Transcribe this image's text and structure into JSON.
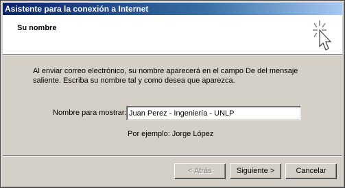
{
  "window": {
    "title": "Asistente para la conexión a Internet"
  },
  "header": {
    "title": "Su nombre",
    "icon": "wizard-cursor-sparkle-icon"
  },
  "body": {
    "description": "Al enviar correo electrónico, su nombre aparecerá en el campo De del mensaje saliente. Escriba su nombre tal y como desea que aparezca.",
    "name_label": "Nombre para mostrar:",
    "name_value": "Juan Perez - Ingeniería - UNLP",
    "example": "Por ejemplo: Jorge López"
  },
  "buttons": {
    "back": "< Atrás",
    "next": "Siguiente >",
    "cancel": "Cancelar"
  },
  "colors": {
    "titlebar_start": "#0a246a",
    "titlebar_end": "#a6caf0",
    "face": "#d4d0c8"
  }
}
